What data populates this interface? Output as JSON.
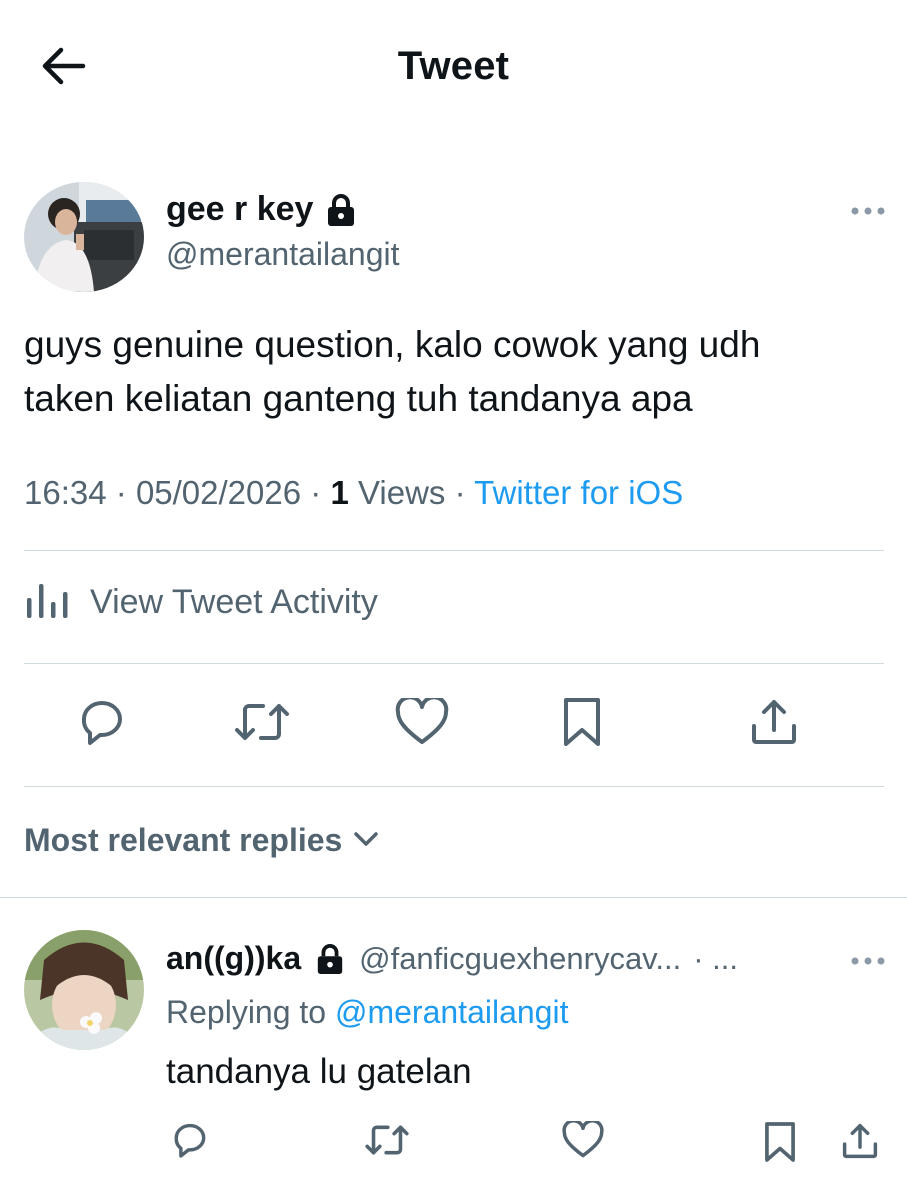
{
  "header": {
    "title": "Tweet",
    "back_icon": "arrow-left-icon"
  },
  "tweet": {
    "author": {
      "name": "gee r key",
      "handle": "@merantailangit",
      "protected_icon": "lock-icon"
    },
    "text_lines": [
      "guys genuine question, kalo cowok yang udh",
      "taken keliatan ganteng tuh tandanya apa"
    ],
    "time": "16:34",
    "date": "05/02/2026",
    "separator": "·",
    "views_count": "1",
    "views_label": "Views",
    "source": "Twitter for iOS",
    "activity_label": "View Tweet Activity",
    "actions": [
      "reply-icon",
      "retweet-icon",
      "like-icon",
      "bookmark-icon",
      "share-icon"
    ]
  },
  "replies": {
    "sort_label": "Most relevant replies",
    "items": [
      {
        "name": "an((g))ka",
        "handle": "@fanficguexhenrycav...",
        "trailing": "· ...",
        "replying_prefix": "Replying to",
        "replying_to": "@merantailangit",
        "text": "tandanya lu gatelan"
      }
    ]
  },
  "colors": {
    "text": "#0f1419",
    "secondary": "#536471",
    "accent": "#1d9bf0",
    "divider": "#cfd9de"
  }
}
